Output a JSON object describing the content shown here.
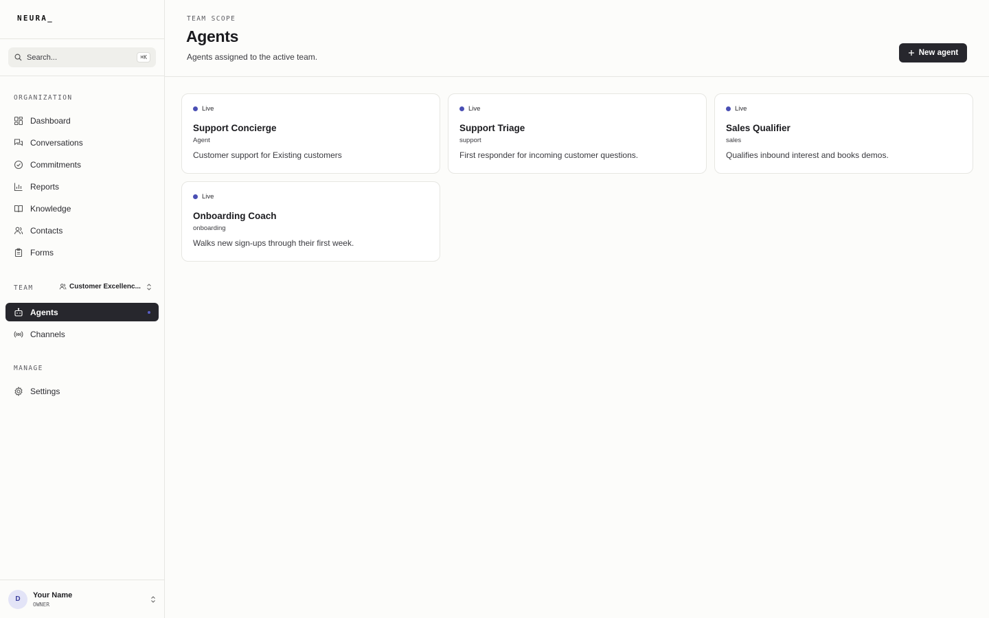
{
  "app": {
    "logo": "NEURA_"
  },
  "search": {
    "placeholder": "Search...",
    "shortcut": "⌘K"
  },
  "sidebar": {
    "organization_label": "ORGANIZATION",
    "org_items": [
      {
        "label": "Dashboard",
        "icon": "dashboard-icon"
      },
      {
        "label": "Conversations",
        "icon": "conversations-icon"
      },
      {
        "label": "Commitments",
        "icon": "check-circle-icon"
      },
      {
        "label": "Reports",
        "icon": "bar-chart-icon"
      },
      {
        "label": "Knowledge",
        "icon": "book-icon"
      },
      {
        "label": "Contacts",
        "icon": "users-icon"
      },
      {
        "label": "Forms",
        "icon": "clipboard-icon"
      }
    ],
    "team_label": "TEAM",
    "team_name": "Customer Excellenc...",
    "team_items": [
      {
        "label": "Agents",
        "icon": "bot-icon",
        "active": true
      },
      {
        "label": "Channels",
        "icon": "broadcast-icon"
      }
    ],
    "manage_label": "MANAGE",
    "manage_items": [
      {
        "label": "Settings",
        "icon": "gear-icon"
      }
    ]
  },
  "user": {
    "initial": "D",
    "name": "Your Name",
    "role": "OWNER"
  },
  "header": {
    "eyebrow": "TEAM SCOPE",
    "title": "Agents",
    "subtitle": "Agents assigned to the active team.",
    "new_button": "New agent"
  },
  "agents": [
    {
      "status": "Live",
      "name": "Support Concierge",
      "tag": "Agent",
      "description": "Customer support for Existing customers"
    },
    {
      "status": "Live",
      "name": "Support Triage",
      "tag": "support",
      "description": "First responder for incoming customer questions."
    },
    {
      "status": "Live",
      "name": "Sales Qualifier",
      "tag": "sales",
      "description": "Qualifies inbound interest and books demos."
    },
    {
      "status": "Live",
      "name": "Onboarding Coach",
      "tag": "onboarding",
      "description": "Walks new sign-ups through their first week."
    }
  ],
  "colors": {
    "accent": "#4a4fb4",
    "dark": "#27272d",
    "background": "#fcfcfa"
  }
}
